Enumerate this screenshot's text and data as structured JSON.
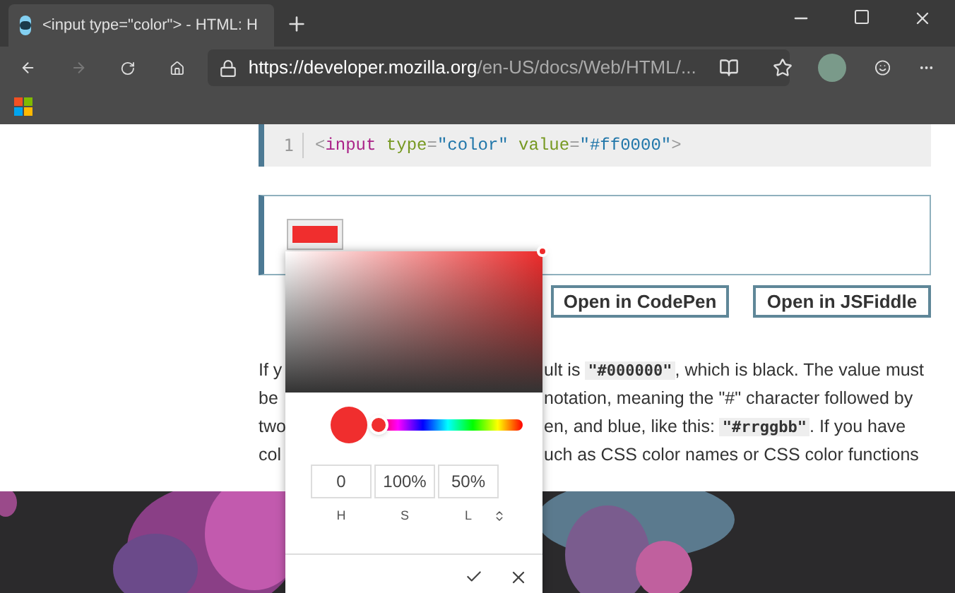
{
  "browser": {
    "tab": {
      "title": "<input type=\"color\"> - HTML: H",
      "selected": true
    },
    "url": {
      "host": "https://developer.mozilla.org",
      "path": "/en-US/docs/Web/HTML/..."
    },
    "forward_disabled": true
  },
  "code_example": {
    "line_number": "1",
    "tokens": [
      {
        "kind": "punct",
        "text": "<"
      },
      {
        "kind": "tag",
        "text": "input"
      },
      {
        "kind": "attr",
        "text": " type"
      },
      {
        "kind": "punct",
        "text": "="
      },
      {
        "kind": "string",
        "text": "\"color\""
      },
      {
        "kind": "attr",
        "text": " value"
      },
      {
        "kind": "punct",
        "text": "="
      },
      {
        "kind": "string",
        "text": "\"#ff0000\""
      },
      {
        "kind": "punct",
        "text": ">"
      }
    ]
  },
  "buttons": [
    "Open in CodePen",
    "Open in JSFiddle"
  ],
  "paragraph": [
    {
      "left": "If y",
      "right": [
        {
          "kind": "text",
          "text": "ult is "
        },
        {
          "kind": "code",
          "text": "\"#000000\""
        },
        {
          "kind": "text",
          "text": ", which is black. The value must"
        }
      ]
    },
    {
      "left": "be",
      "right": [
        {
          "kind": "text",
          "text": "notation, meaning the \"#\" character followed by"
        }
      ]
    },
    {
      "left": "two",
      "right": [
        {
          "kind": "text",
          "text": "en, and blue, like this: "
        },
        {
          "kind": "code",
          "text": "\"#rrggbb\""
        },
        {
          "kind": "text",
          "text": ". If you have"
        }
      ]
    },
    {
      "left": "col",
      "right": [
        {
          "kind": "text",
          "text": "uch as CSS color names or CSS color functions"
        }
      ]
    }
  ],
  "picker": {
    "hue": {
      "level": 0.04
    },
    "fields": [
      {
        "value": "0",
        "label": "H"
      },
      {
        "value": "100%",
        "label": "S"
      },
      {
        "value": "50%",
        "label": "L"
      }
    ]
  }
}
